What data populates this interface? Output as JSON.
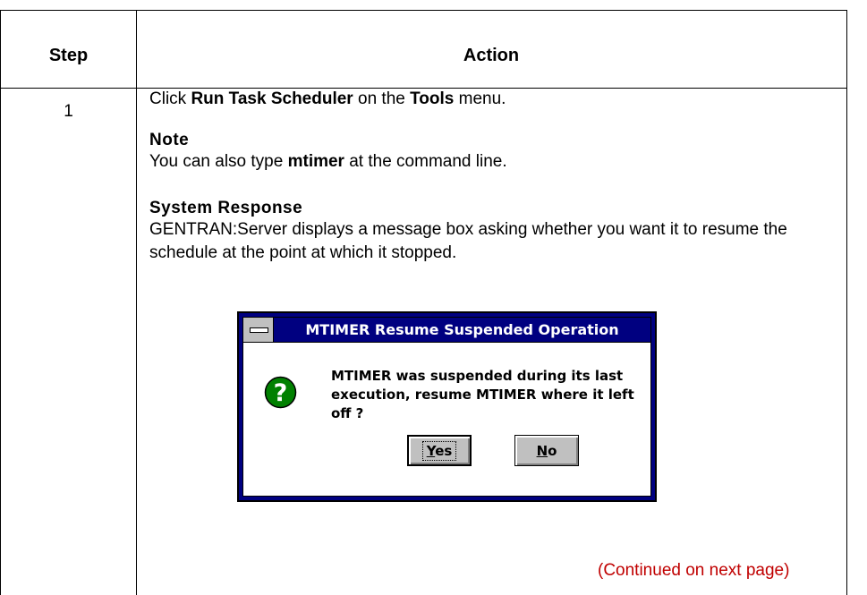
{
  "table": {
    "header_step": "Step",
    "header_action": "Action"
  },
  "row1": {
    "step_number": "1",
    "instruction_prefix": "Click ",
    "instruction_bold1": "Run Task Scheduler",
    "instruction_mid": " on the ",
    "instruction_bold2": "Tools",
    "instruction_suffix": " menu.",
    "note_heading": "Note",
    "note_prefix": "You can also type ",
    "note_bold": "mtimer",
    "note_suffix": " at the command line.",
    "response_heading": "System Response",
    "response_text": "GENTRAN:Server displays a message box asking whether you want it to resume the schedule at the point at which it stopped."
  },
  "dialog": {
    "title": "MTIMER Resume Suspended Operation",
    "message_line1": "MTIMER was suspended during its last",
    "message_line2": "execution, resume MTIMER where it left off ?",
    "yes_first": "Y",
    "yes_rest": "es",
    "no_first": "N",
    "no_rest": "o",
    "icon": "question-icon",
    "icon_color": "#008000",
    "title_color": "#000080"
  },
  "footer": {
    "continued": "(Continued on next page)",
    "continued_color": "#c00000"
  }
}
